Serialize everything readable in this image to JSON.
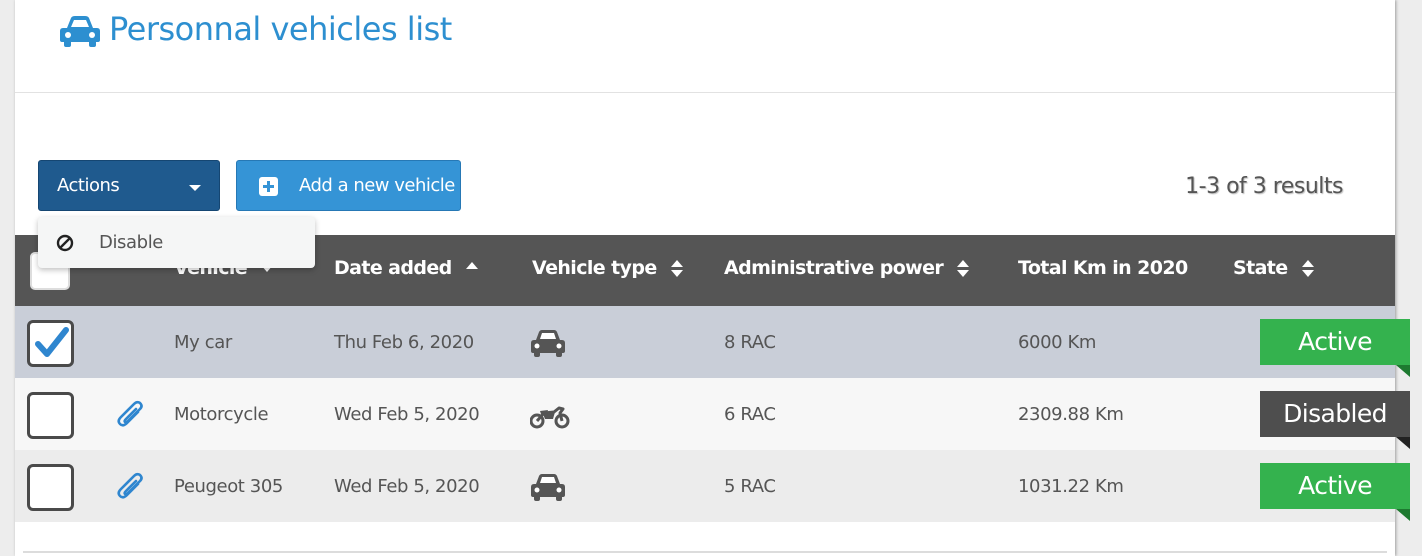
{
  "header": {
    "title": "Personnal vehicles list",
    "icon": "car-icon",
    "title_color": "#2d8fd0"
  },
  "toolbar": {
    "actions_label": "Actions",
    "add_label": "Add a new vehicle",
    "results": "1-3 of 3 results"
  },
  "dropdown": {
    "items": [
      {
        "label": "Disable",
        "icon": "ban-icon"
      }
    ]
  },
  "table": {
    "columns": [
      {
        "label": "Vehicle",
        "sort": "desc"
      },
      {
        "label": "Date added",
        "sort": "asc"
      },
      {
        "label": "Vehicle type",
        "sort": "both"
      },
      {
        "label": "Administrative power",
        "sort": "both"
      },
      {
        "label": "Total Km in 2020",
        "sort": "none"
      },
      {
        "label": "State",
        "sort": "both"
      }
    ],
    "rows": [
      {
        "checked": true,
        "attachment": false,
        "vehicle": "My car",
        "date": "Thu Feb 6, 2020",
        "type_icon": "car-icon",
        "power": "8 RAC",
        "km": "6000 Km",
        "state": "Active"
      },
      {
        "checked": false,
        "attachment": true,
        "vehicle": "Motorcycle",
        "date": "Wed Feb 5, 2020",
        "type_icon": "motorcycle-icon",
        "power": "6 RAC",
        "km": "2309.88 Km",
        "state": "Disabled"
      },
      {
        "checked": false,
        "attachment": true,
        "vehicle": "Peugeot 305",
        "date": "Wed Feb 5, 2020",
        "type_icon": "car-icon",
        "power": "5 RAC",
        "km": "1031.22 Km",
        "state": "Active"
      }
    ]
  },
  "colors": {
    "active": "#34b24e",
    "disabled": "#4e4e4e",
    "header_bg": "#555555",
    "actions_bg": "#1f5a8e",
    "add_bg": "#3594d6"
  }
}
